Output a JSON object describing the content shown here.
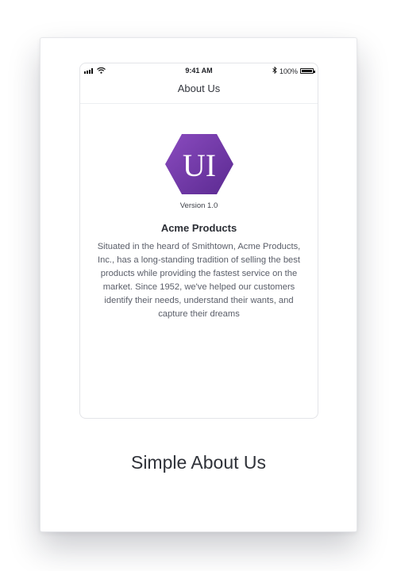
{
  "status_bar": {
    "time": "9:41 AM",
    "battery_text": "100%",
    "icons": [
      "signal-icon",
      "wifi-icon",
      "bluetooth-icon",
      "battery-icon"
    ]
  },
  "nav": {
    "title": "About Us"
  },
  "logo": {
    "text": "UI",
    "icon": "hexagon-logo-icon",
    "colors": {
      "gradient_start": "#8a4bbf",
      "gradient_end": "#5b2a91"
    }
  },
  "about": {
    "version": "Version 1.0",
    "company": "Acme Products",
    "description": "Situated in the heard of Smithtown, Acme Products, Inc., has a long-standing tradition of selling the best products while providing the fastest service on the market. Since 1952, we've helped our customers identify their needs, understand their wants, and capture their dreams"
  },
  "caption": "Simple About Us"
}
